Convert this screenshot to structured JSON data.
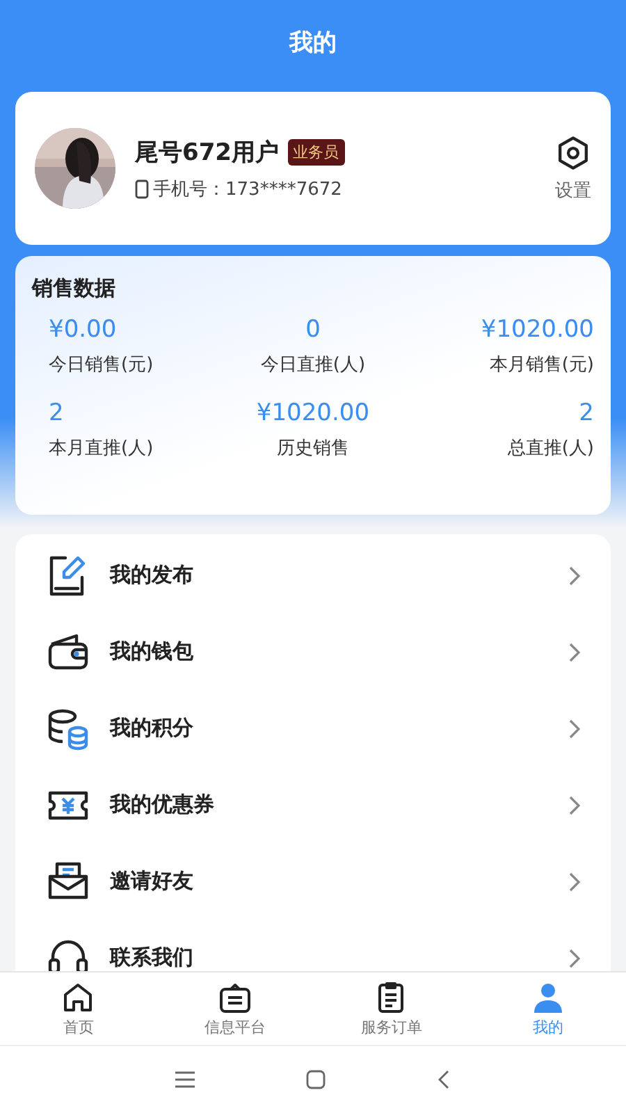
{
  "header": {
    "title": "我的"
  },
  "profile": {
    "name": "尾号672用户",
    "role_badge": "业务员",
    "phone": "手机号：173****7672",
    "settings_label": "设置"
  },
  "sales": {
    "title": "销售数据",
    "stats": [
      {
        "value": "¥0.00",
        "label": "今日销售(元)"
      },
      {
        "value": "0",
        "label": "今日直推(人)"
      },
      {
        "value": "¥1020.00",
        "label": "本月销售(元)"
      },
      {
        "value": "2",
        "label": "本月直推(人)"
      },
      {
        "value": "¥1020.00",
        "label": "历史销售"
      },
      {
        "value": "2",
        "label": "总直推(人)"
      }
    ]
  },
  "menu": [
    {
      "label": "我的发布",
      "kind": "edit"
    },
    {
      "label": "我的钱包",
      "kind": "wallet"
    },
    {
      "label": "我的积分",
      "kind": "coins"
    },
    {
      "label": "我的优惠券",
      "kind": "coupon"
    },
    {
      "label": "邀请好友",
      "kind": "mail"
    },
    {
      "label": "联系我们",
      "kind": "headset"
    }
  ],
  "tab_bar": [
    {
      "label": "首页",
      "kind": "home",
      "selected": false
    },
    {
      "label": "信息平台",
      "kind": "board",
      "selected": false
    },
    {
      "label": "服务订单",
      "kind": "clipboard",
      "selected": false
    },
    {
      "label": "我的",
      "kind": "person",
      "selected": true
    }
  ]
}
